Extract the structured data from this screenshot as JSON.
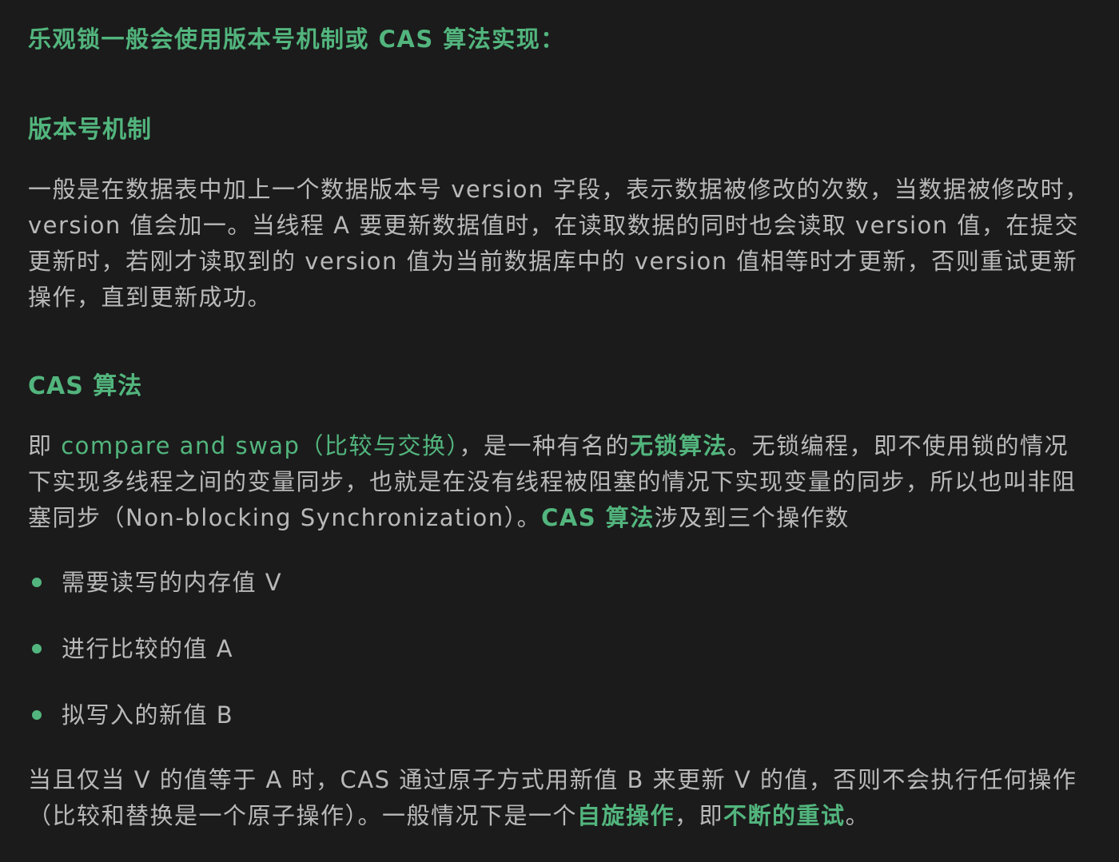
{
  "intro": "乐观锁一般会使用版本号机制或 CAS 算法实现：",
  "section_version": {
    "heading": "版本号机制",
    "paragraph": "一般是在数据表中加上一个数据版本号 version 字段，表示数据被修改的次数，当数据被修改时，version 值会加一。当线程 A 要更新数据值时，在读取数据的同时也会读取 version 值，在提交更新时，若刚才读取到的 version 值为当前数据库中的 version 值相等时才更新，否则重试更新操作，直到更新成功。"
  },
  "section_cas": {
    "heading": "CAS 算法",
    "para_prefix": "即 ",
    "para_code": "compare and swap",
    "para_paren": "（比较与交换）",
    "para_mid1": "，是一种有名的",
    "para_bold1": "无锁算法",
    "para_mid2": "。无锁编程，即不使用锁的情况下实现多线程之间的变量同步，也就是在没有线程被阻塞的情况下实现变量的同步，所以也叫非阻塞同步（Non-blocking Synchronization）。",
    "para_bold2": "CAS 算法",
    "para_tail": "涉及到三个操作数",
    "bullets": [
      "需要读写的内存值 V",
      "进行比较的值 A",
      "拟写入的新值 B"
    ],
    "final_prefix": "当且仅当 V 的值等于 A 时，CAS 通过原子方式用新值 B 来更新 V 的值，否则不会执行任何操作（比较和替换是一个原子操作）。一般情况下是一个",
    "final_bold1": "自旋操作",
    "final_mid": "，即",
    "final_bold2": "不断的重试",
    "final_end": "。"
  }
}
